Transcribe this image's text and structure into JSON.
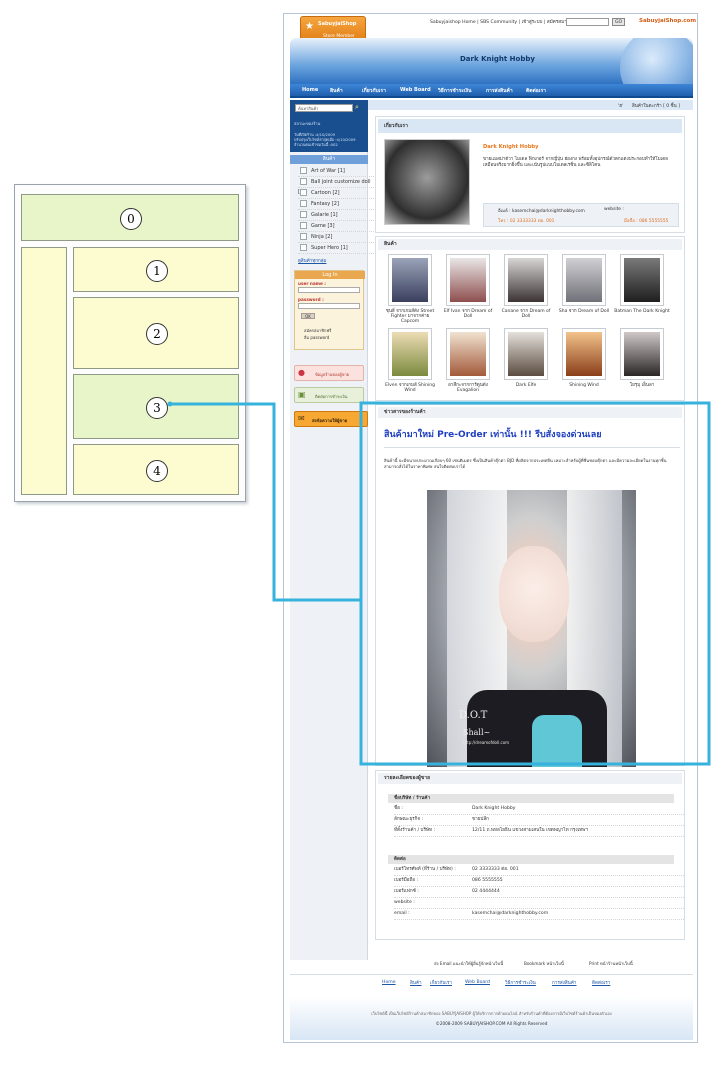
{
  "wireframe": {
    "labels": [
      "0",
      "1",
      "2",
      "3",
      "4"
    ],
    "colors": {
      "green": "#e8f5c8",
      "yellow": "#fdfbd0",
      "connector": "#36b2dd"
    }
  },
  "screenshot": {
    "topbar": {
      "logo_name": "SabuyjaiShop",
      "logo_sub": "Store Member",
      "links": "Sabuyjaishop Home | SBS Community | เข้าสู่ระบบ | สมัครสมาชิก | Help |",
      "go": "GO",
      "brand": "SabuyjaiShop.com"
    },
    "banner": {
      "title": "Dark Knight Hobby"
    },
    "nav": [
      "Home",
      "สินค้า",
      "เกี่ยวกับเรา",
      "Web Board",
      "วิธีการชำระเงิน",
      "การส่งสินค้า",
      "ติดต่อเรา"
    ],
    "cartbar": {
      "symbol": "'ฮ'",
      "label": "สินค้าในตะกร้า [ 0 ชิ้น ]"
    },
    "sidebar": {
      "search_placeholder": "ค้นหาสินค้า",
      "stats_title": "สถานะของร้าน",
      "stats": [
        "วันที่เปิดร้าน :4/10/2009",
        "ปรับปรุงเว็บไซต์ล่าสุดเมื่อ :4/10/2009",
        "จำนวนคนเข้าชมวันนี้ :002"
      ],
      "cat_header": "สินค้า",
      "categories": [
        "Art of War [1]",
        "Ball joint customize doll [3]",
        "Cartoon [2]",
        "Fantasy [2]",
        "Galarie [1]",
        "Game [3]",
        "Ninja [2]",
        "Super Hero [1]"
      ],
      "all_cats": "ดูสินค้าทุกกลุ่ม",
      "login_title": "Log In",
      "user_label": "user name :",
      "pass_label": "password :",
      "ok": "OK",
      "register": "สมัครสมาชิกฟรี",
      "forgot": "ลืม password",
      "btn1": "ข้อมูลร้านของผู้ขาย",
      "btn2": "ติดต่อการชำระเงิน",
      "btn3": "ส่งข้อความให้ผู้ขาย"
    },
    "about": {
      "header": "เกี่ยวกับเรา",
      "shop_name": "Dark Knight Hobby",
      "description": "ขายแมสม่าตัวา ไมเดล ฟิกเกอร์ จากญี่ปุ่น ฮ่องกง พร้อมทั้งอุปกรณ์ตัวตกแต่งประกอบทำให้โมเดลเหมือนจริงมากยิ่งขึ้น และเน้นรูปแบบโมเดลเรซิ่น และซิลิโคน",
      "email": "อีเมล์ : kasemchai@darknighthobby.com",
      "website": "website :",
      "phone": "โทร : 02 3333333 ต่อ. 001",
      "mobile": "มือถือ : 086 5555555"
    },
    "products": {
      "header": "สินค้า",
      "items": [
        "ชุนลี่ จากเกมส์ดัง Street Fighter มาจากค่าย Capcom",
        "Elf Ivan จาก Dream of Doll",
        "Canane จาก Dream of Doll",
        "Sha จาก Dream of Doll",
        "Batman The Dark Knight",
        "Elven จากเกมส์ Shining Wind",
        "อาสึกะจากการ์ตูนดัง Evagalion",
        "Dark Elfe",
        "Shining Wind",
        "โยรุมุ เอ็นลา"
      ]
    },
    "news": {
      "header": "ข่าวสารของร้านค้า",
      "headline": "สินค้ามาใหม่ Pre-Order เท่านั้น !!! รีบสั่งจองด่วนเลย",
      "body": "สินค้านี้ จะมีขนาดประมาณเกือบๆ 60 เซนติเมตร ซึ่งเป็นสินค้าตุ๊กตา BJD ที่ผลิตจากประเทศจีน เหมาะสำหรับผู้ที่ชื่นชอบตุ๊กตา และมีความละเอียดในงานทุกชิ้น สามารถสั่งได้ในราคาพิเศษ สนใจติดต่อเราได้",
      "watermark1": "D.O.T",
      "watermark2": "Shall~",
      "watermark3": "http://dreamofdoll.com"
    },
    "seller": {
      "header": "รายละเอียดของผู้ขาย",
      "sec1": "ชื่อบริษัท / ร้านค้า",
      "rows1": [
        [
          "ชื่อ :",
          "Dark Knight Hobby"
        ],
        [
          "ลักษณะธุรกิจ :",
          "ขายปลีก"
        ],
        [
          "ที่ตั้งร้านค้า / บริษัท :",
          "12/11 ถ.พหลโยธิน แขวงสามเสนใน เขตพญาไท กรุงเทพฯ"
        ]
      ],
      "sec2": "ติดต่อ",
      "rows2": [
        [
          "เบอร์โทรศัพท์ (ที่ร้าน / บริษัท) :",
          "02 3333333 ต่อ. 001"
        ],
        [
          "เบอร์มือถือ :",
          "086 5555555"
        ],
        [
          "เบอร์แฟกซ์ :",
          "02 4444444"
        ],
        [
          "website :",
          ""
        ],
        [
          "email :",
          "kasemchai@darknighthobby.com"
        ]
      ]
    },
    "footer_links": [
      "ส่ง Email แนะนำให้ผู้อื่นรู้จักหน้าเว็บนี้",
      "Bookmark หน้าเว็บนี้",
      "Print หน้าร้านหน้าเว็บนี้"
    ],
    "bottom_nav": [
      "Home",
      "สินค้า",
      "เกี่ยวกับเรา",
      "Web Board",
      "วิธีการชำระเงิน",
      "การส่งสินค้า",
      "ติดต่อเรา"
    ],
    "bottom_note": "เว็บไซต์นี้ เป็นเว็บไซต์ร้านค้าสมาชิกของ SABUYJAISHOP ผู้ให้บริการการค้าออนไลน์ สำหรับร้านค้าที่ต้องการมีเว็บไซต์ร้านค้าเป็นของตัวเอง",
    "copyright": "©2008-2009 SABUYJAISHOP.COM All Rights Reserved"
  }
}
